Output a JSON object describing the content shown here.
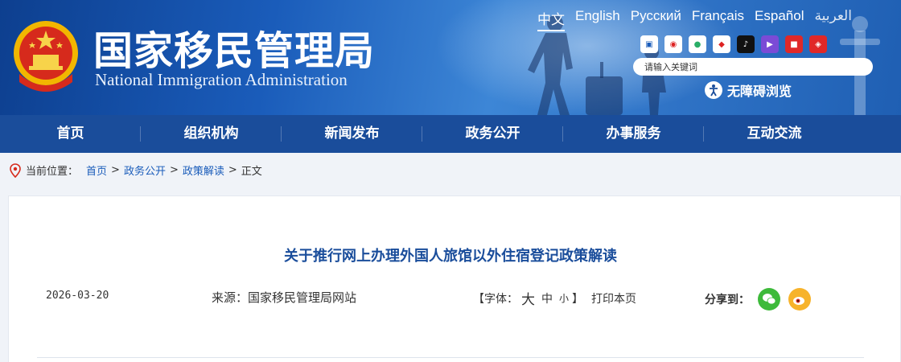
{
  "header": {
    "title_cn": "国家移民管理局",
    "title_en": "National Immigration Administration",
    "languages": [
      {
        "label": "中文",
        "active": true
      },
      {
        "label": "English"
      },
      {
        "label": "Русский"
      },
      {
        "label": "Français"
      },
      {
        "label": "Español"
      },
      {
        "label": "العربية"
      }
    ],
    "social_icons": [
      "app-icon",
      "weibo-icon",
      "wechat-icon",
      "media-icon",
      "douyin-icon",
      "video-icon",
      "toutiao-icon",
      "kuaishou-icon"
    ],
    "search_placeholder": "请输入关键词",
    "accessible_label": "无障碍浏览"
  },
  "nav": {
    "items": [
      "首页",
      "组织机构",
      "新闻发布",
      "政务公开",
      "办事服务",
      "互动交流"
    ]
  },
  "breadcrumb": {
    "prefix": "当前位置：",
    "items": [
      "首页",
      "政务公开",
      "政策解读"
    ],
    "current": "正文"
  },
  "article": {
    "title": "关于推行网上办理外国人旅馆以外住宿登记政策解读",
    "date": "2026-03-20",
    "source": "来源：国家移民管理局网站",
    "font_open": "【字体：",
    "font_large": "大",
    "font_medium": "中",
    "font_small": "小",
    "font_close": "】",
    "print": "打印本页",
    "share_label": "分享到："
  },
  "colors": {
    "nav_bg": "#1a4d9b",
    "title_blue": "#1a4d9b",
    "link_blue": "#1a5cba"
  }
}
